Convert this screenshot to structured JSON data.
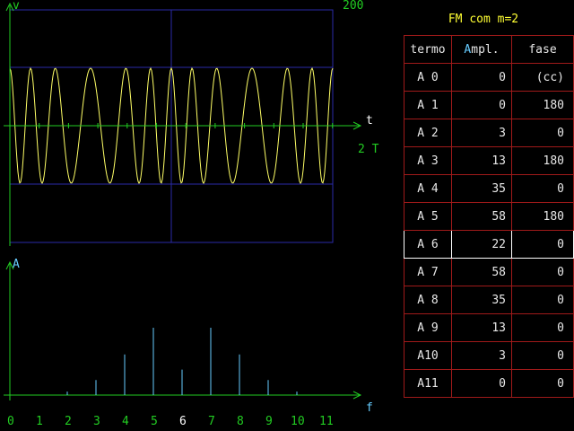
{
  "scope": {
    "y_label": "v",
    "x_label": "t",
    "scale_label": "200",
    "period_label": "2 T"
  },
  "spectrum": {
    "y_label": "A",
    "x_label": "f",
    "ticks": [
      "0",
      "1",
      "2",
      "3",
      "4",
      "5",
      "6",
      "7",
      "8",
      "9",
      "10",
      "11"
    ],
    "selected_tick": "6"
  },
  "table": {
    "title": "FM com m=2",
    "headers": {
      "termo": "termo",
      "ampl_prefix": "A",
      "ampl_rest": "mpl.",
      "fase": "fase"
    },
    "selected_row": 6,
    "rows": [
      {
        "termo": "A 0",
        "ampl": "0",
        "fase": "(cc)"
      },
      {
        "termo": "A 1",
        "ampl": "0",
        "fase": "180"
      },
      {
        "termo": "A 2",
        "ampl": "3",
        "fase": "0"
      },
      {
        "termo": "A 3",
        "ampl": "13",
        "fase": "180"
      },
      {
        "termo": "A 4",
        "ampl": "35",
        "fase": "0"
      },
      {
        "termo": "A 5",
        "ampl": "58",
        "fase": "180"
      },
      {
        "termo": "A 6",
        "ampl": "22",
        "fase": "0"
      },
      {
        "termo": "A 7",
        "ampl": "58",
        "fase": "0"
      },
      {
        "termo": "A 8",
        "ampl": "35",
        "fase": "0"
      },
      {
        "termo": "A 9",
        "ampl": "13",
        "fase": "0"
      },
      {
        "termo": "A10",
        "ampl": "3",
        "fase": "0"
      },
      {
        "termo": "A11",
        "ampl": "0",
        "fase": "0"
      }
    ]
  },
  "colors": {
    "axis": "#22cc22",
    "grid": "#2a2aa8",
    "wave": "#ffff66",
    "bar": "#66ccff",
    "table_border": "#a01a1a"
  }
}
